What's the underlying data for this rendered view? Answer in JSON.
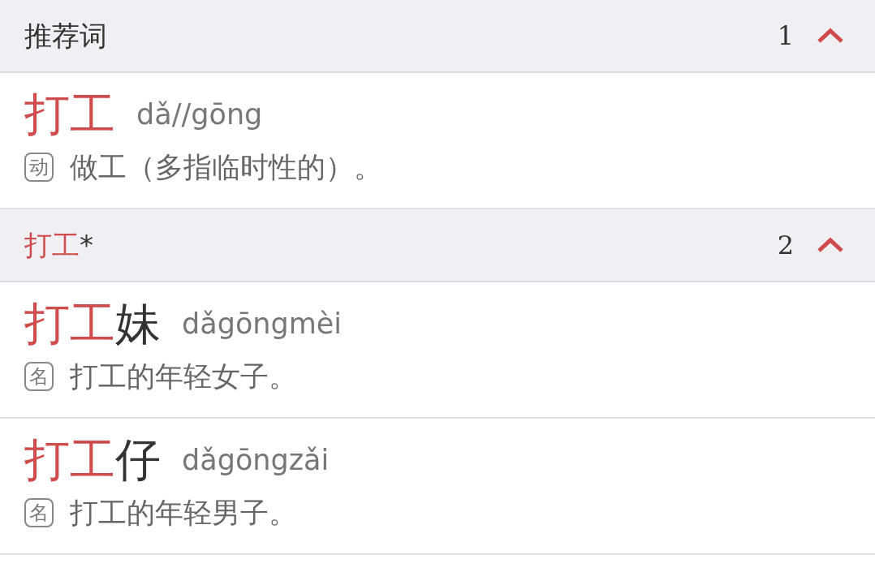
{
  "sections": [
    {
      "title": [
        {
          "text": "推荐词",
          "highlight": false
        }
      ],
      "count": "1",
      "expanded": true,
      "entries": [
        {
          "headword": [
            {
              "text": "打工",
              "highlight": true
            }
          ],
          "pinyin": "dǎ//gōng",
          "pos": "动",
          "definition": "做工（多指临时性的）。"
        }
      ]
    },
    {
      "title": [
        {
          "text": "打工",
          "highlight": true
        },
        {
          "text": "*",
          "highlight": false
        }
      ],
      "count": "2",
      "expanded": true,
      "entries": [
        {
          "headword": [
            {
              "text": "打工",
              "highlight": true
            },
            {
              "text": "妹",
              "highlight": false
            }
          ],
          "pinyin": "dǎgōngmèi",
          "pos": "名",
          "definition": "打工的年轻女子。"
        },
        {
          "headword": [
            {
              "text": "打工",
              "highlight": true
            },
            {
              "text": "仔",
              "highlight": false
            }
          ],
          "pinyin": "dǎgōngzǎi",
          "pos": "名",
          "definition": "打工的年轻男子。"
        }
      ]
    }
  ]
}
